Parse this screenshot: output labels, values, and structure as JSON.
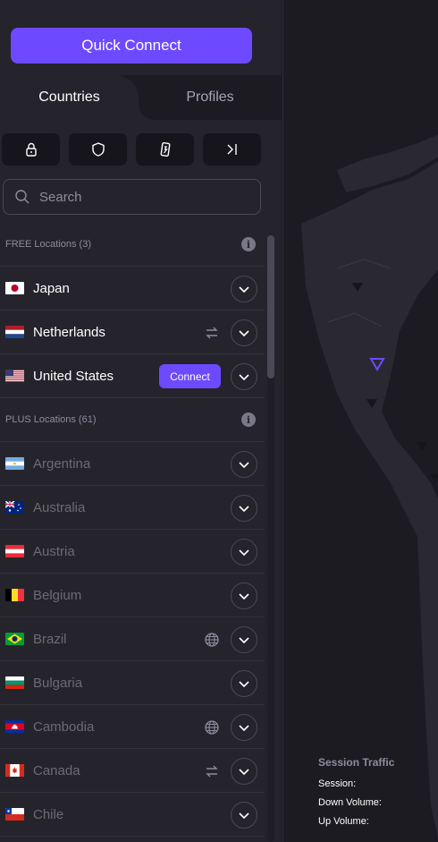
{
  "quick_connect": {
    "label": "Quick Connect"
  },
  "tabs": [
    {
      "label": "Countries",
      "active": true
    },
    {
      "label": "Profiles",
      "active": false
    }
  ],
  "filters": [
    {
      "icon": "secure-core-lock-icon"
    },
    {
      "icon": "shield-icon"
    },
    {
      "icon": "p2p-icon"
    },
    {
      "icon": "tor-arrow-icon"
    }
  ],
  "search": {
    "placeholder": "Search",
    "value": ""
  },
  "sections": {
    "free": {
      "label": "FREE Locations (3)"
    },
    "plus": {
      "label": "PLUS Locations (61)"
    }
  },
  "free_countries": [
    {
      "name": "Japan",
      "flag": "jp"
    },
    {
      "name": "Netherlands",
      "flag": "nl",
      "feature": "p2p-swap-icon"
    },
    {
      "name": "United States",
      "flag": "us",
      "connect_label": "Connect"
    }
  ],
  "plus_countries": [
    {
      "name": "Argentina",
      "flag": "ar"
    },
    {
      "name": "Australia",
      "flag": "au"
    },
    {
      "name": "Austria",
      "flag": "at"
    },
    {
      "name": "Belgium",
      "flag": "be"
    },
    {
      "name": "Brazil",
      "flag": "br",
      "feature": "globe-icon"
    },
    {
      "name": "Bulgaria",
      "flag": "bg"
    },
    {
      "name": "Cambodia",
      "flag": "kh",
      "feature": "globe-icon"
    },
    {
      "name": "Canada",
      "flag": "ca",
      "feature": "p2p-swap-icon"
    },
    {
      "name": "Chile",
      "flag": "cl"
    }
  ],
  "session_traffic": {
    "title": "Session Traffic",
    "session_label": "Session:",
    "down_label": "Down Volume:",
    "up_label": "Up Volume:"
  },
  "colors": {
    "accent": "#6d4aff",
    "sidebar_bg": "#25242c",
    "map_bg": "#1c1b22",
    "land": "#2a2931"
  }
}
